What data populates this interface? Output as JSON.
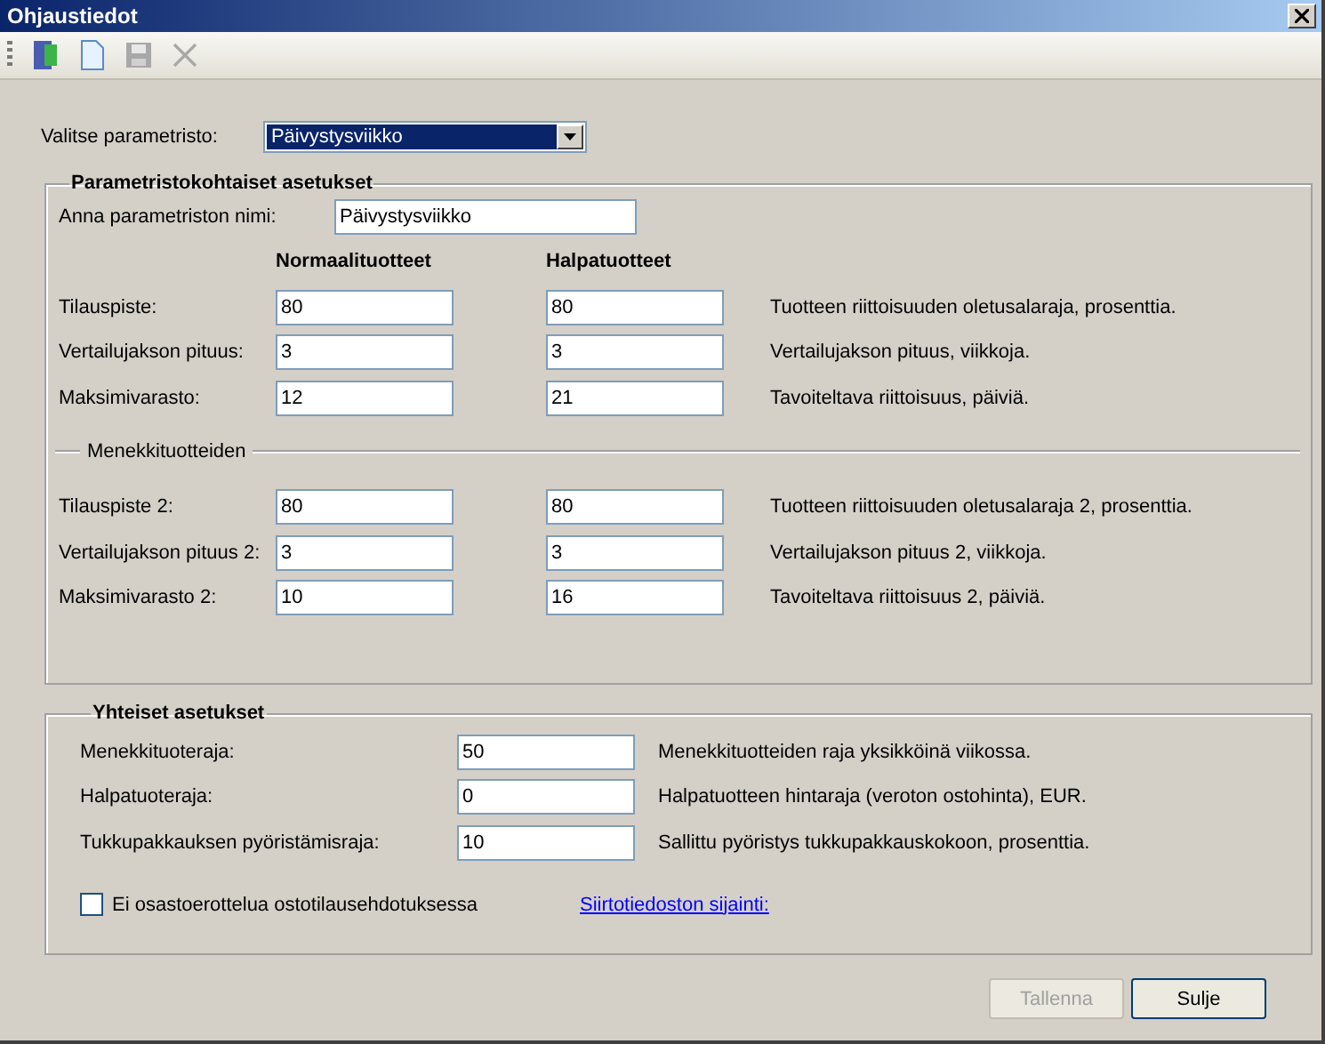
{
  "window": {
    "title": "Ohjaustiedot"
  },
  "toolbar": [
    {
      "kind": "exit",
      "disabled": false
    },
    {
      "kind": "new",
      "disabled": false
    },
    {
      "kind": "save",
      "disabled": true
    },
    {
      "kind": "delete",
      "disabled": true
    }
  ],
  "selector": {
    "label": "Valitse parametristo:",
    "value": "Päivystysviikko"
  },
  "param_section": {
    "title": "Parametristokohtaiset asetukset",
    "name_label": "Anna parametriston nimi:",
    "name_value": "Päivystysviikko",
    "column_headers": [
      "Normaalituotteet",
      "Halpatuotteet"
    ],
    "rows": [
      {
        "label": "Tilauspiste:",
        "normal": "80",
        "cheap": "80",
        "description": "Tuotteen riittoisuuden oletusalaraja, prosenttia."
      },
      {
        "label": "Vertailujakson pituus:",
        "normal": "3",
        "cheap": "3",
        "description": "Vertailujakson pituus, viikkoja."
      },
      {
        "label": "Maksimivarasto:",
        "normal": "12",
        "cheap": "21",
        "description": "Tavoiteltava riittoisuus, päiviä."
      }
    ],
    "subsection_title": "Menekkituotteiden",
    "sub_rows": [
      {
        "label": "Tilauspiste 2:",
        "normal": "80",
        "cheap": "80",
        "description": "Tuotteen riittoisuuden oletusalaraja 2, prosenttia."
      },
      {
        "label": "Vertailujakson pituus 2:",
        "normal": "3",
        "cheap": "3",
        "description": "Vertailujakson pituus 2, viikkoja."
      },
      {
        "label": "Maksimivarasto 2:",
        "normal": "10",
        "cheap": "16",
        "description": "Tavoiteltava riittoisuus 2, päiviä."
      }
    ]
  },
  "common_section": {
    "title": "Yhteiset asetukset",
    "rows": [
      {
        "label": "Menekkituoteraja:",
        "value": "50",
        "description": "Menekkituotteiden raja yksikköinä viikossa."
      },
      {
        "label": "Halpatuoteraja:",
        "value": "0",
        "description": "Halpatuotteen hintaraja (veroton ostohinta), EUR."
      },
      {
        "label": "Tukkupakkauksen pyöristämisraja:",
        "value": "10",
        "description": "Sallittu pyöristys tukkupakkauskokoon, prosenttia."
      }
    ],
    "checkbox": {
      "label": "Ei osastoerottelua ostotilausehdotuksessa",
      "checked": false
    },
    "link": "Siirtotiedoston sijainti:"
  },
  "buttons": [
    {
      "label": "Tallenna",
      "disabled": true
    },
    {
      "label": "Sulje",
      "disabled": false
    }
  ]
}
